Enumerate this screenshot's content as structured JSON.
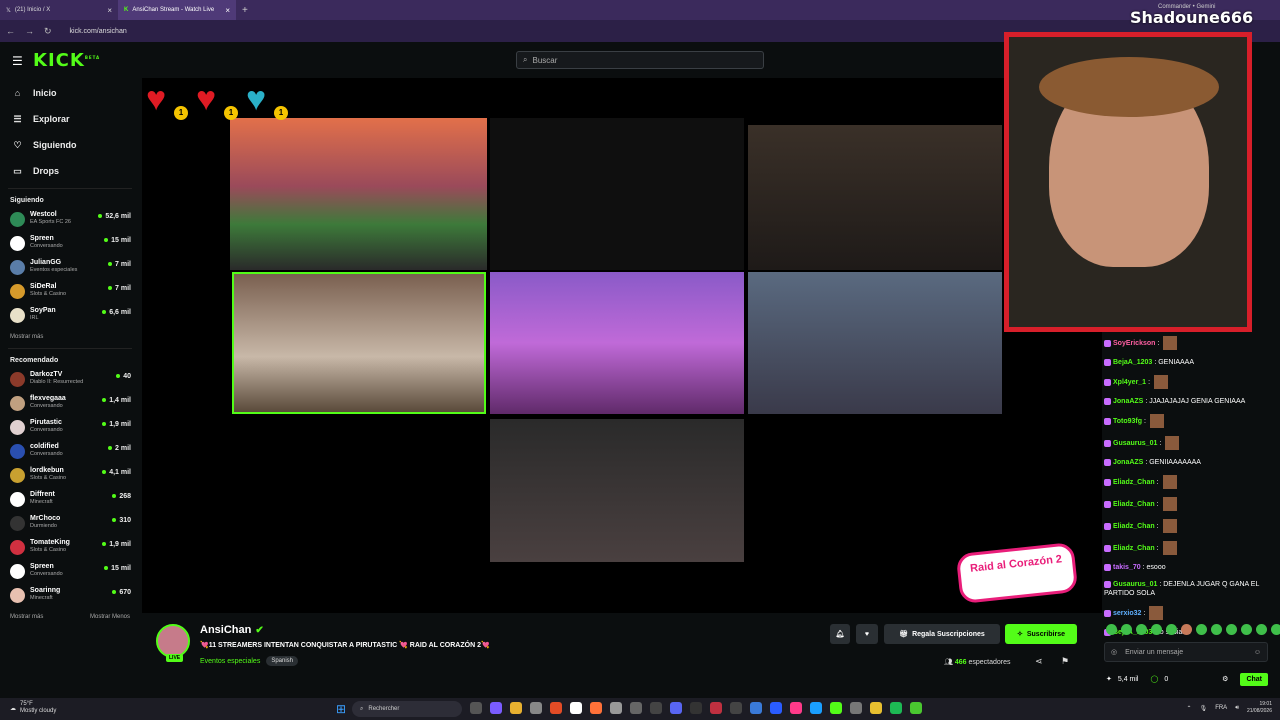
{
  "browser": {
    "tabs": [
      {
        "label": "(21) Inicio / X",
        "active": false
      },
      {
        "label": "AnsiChan Stream - Watch Live",
        "active": true
      }
    ],
    "url": "kick.com/ansichan"
  },
  "topbar": {
    "logo": "KICK",
    "logo_sup": "BETA",
    "search_placeholder": "Buscar"
  },
  "sidebar": {
    "nav": [
      {
        "label": "Inicio",
        "icon": "home-icon"
      },
      {
        "label": "Explorar",
        "icon": "compass-icon"
      },
      {
        "label": "Siguiendo",
        "icon": "heart-icon"
      },
      {
        "label": "Drops",
        "icon": "drops-icon"
      }
    ],
    "following_title": "Siguiendo",
    "following": [
      {
        "name": "Westcol",
        "category": "EA Sports FC 26",
        "viewers": "52,6 mil",
        "color": "#2e8b57"
      },
      {
        "name": "Spreen",
        "category": "Conversando",
        "viewers": "15 mil",
        "color": "#ffffff"
      },
      {
        "name": "JulianGG",
        "category": "Eventos especiales",
        "viewers": "7 mil",
        "color": "#5a7da8"
      },
      {
        "name": "SiDeRal",
        "category": "Slots & Casino",
        "viewers": "7 mil",
        "color": "#d69a2b"
      },
      {
        "name": "SoyPan",
        "category": "IRL",
        "viewers": "6,6 mil",
        "color": "#e8e0c8"
      }
    ],
    "following_more": "Mostrar más",
    "recommended_title": "Recomendado",
    "recommended": [
      {
        "name": "DarkozTV",
        "category": "Diablo II: Resurrected",
        "viewers": "40",
        "color": "#8b3a2a"
      },
      {
        "name": "flexvegaaa",
        "category": "Conversando",
        "viewers": "1,4 mil",
        "color": "#c0a080"
      },
      {
        "name": "Pirutastic",
        "category": "Conversando",
        "viewers": "1,9 mil",
        "color": "#e0d0d0"
      },
      {
        "name": "coldified",
        "category": "Conversando",
        "viewers": "2 mil",
        "color": "#2a4fb0"
      },
      {
        "name": "lordkebun",
        "category": "Slots & Casino",
        "viewers": "4,1 mil",
        "color": "#c8a030"
      },
      {
        "name": "Diffrent",
        "category": "Minecraft",
        "viewers": "268",
        "color": "#ffffff"
      },
      {
        "name": "MrChoco",
        "category": "Durmiendo",
        "viewers": "310",
        "color": "#333333"
      },
      {
        "name": "TomateKing",
        "category": "Slots & Casino",
        "viewers": "1,9 mil",
        "color": "#d03040"
      },
      {
        "name": "Spreen",
        "category": "Conversando",
        "viewers": "15 mil",
        "color": "#ffffff"
      },
      {
        "name": "Soarinng",
        "category": "Minecraft",
        "viewers": "670",
        "color": "#e8c0b0"
      }
    ],
    "recommended_more": "Mostrar más",
    "recommended_less": "Mostrar Menos"
  },
  "video": {
    "heart_badges": [
      "1",
      "1",
      "1"
    ],
    "raid_text": "Raid al Corazón 2",
    "cam_name": "Shadoune666",
    "cam_sub": "Commander • Gemini"
  },
  "stream": {
    "name": "AnsiChan",
    "title": "💘11 STREAMERS INTENTAN CONQUISTAR A PIRUTASTIC 💘 RAID AL CORAZÓN 2💘",
    "category": "Eventos especiales",
    "language": "Spanish",
    "live_label": "LIVE",
    "gift_button": "Regala Suscripciones",
    "subscribe_button": "Suscribirse",
    "viewers": "466",
    "viewers_label": "espectadores"
  },
  "chat": {
    "messages": [
      {
        "user": "SoyErickson",
        "color": "#ff5fa2",
        "text": "",
        "emotes": 1
      },
      {
        "user": "BejaA_1203",
        "color": "#53fc18",
        "text": "GENIAAAA",
        "emotes": 0
      },
      {
        "user": "Xpl4yer_1",
        "color": "#53fc18",
        "text": "",
        "emotes": 1
      },
      {
        "user": "JonaAZS",
        "color": "#53fc18",
        "text": "JJAJAJAJAJ GENIA GENIAAA",
        "emotes": 0
      },
      {
        "user": "Toto93fg",
        "color": "#53fc18",
        "text": "",
        "emotes": 1
      },
      {
        "user": "Gusaurus_01",
        "color": "#53fc18",
        "text": "",
        "emotes": 1
      },
      {
        "user": "JonaAZS",
        "color": "#53fc18",
        "text": "GENIIAAAAAAA",
        "emotes": 0
      },
      {
        "user": "Eliadz_Chan",
        "color": "#53fc18",
        "text": "",
        "emotes": 1
      },
      {
        "user": "Eliadz_Chan",
        "color": "#53fc18",
        "text": "",
        "emotes": 1
      },
      {
        "user": "Eliadz_Chan",
        "color": "#53fc18",
        "text": "",
        "emotes": 1
      },
      {
        "user": "Eliadz_Chan",
        "color": "#53fc18",
        "text": "",
        "emotes": 1
      },
      {
        "user": "takis_70",
        "color": "#c86cff",
        "text": "esooo",
        "emotes": 0
      },
      {
        "user": "Gusaurus_01",
        "color": "#53fc18",
        "text": "DEJENLA JUGAR Q GANA EL PARTIDO SOLA",
        "emotes": 0
      },
      {
        "user": "serxio32",
        "color": "#5fb0ff",
        "text": "",
        "emotes": 1
      },
      {
        "user": "BejaA_1203",
        "color": "#53fc18",
        "text": "lo sabiaaa",
        "emotes": 0
      }
    ],
    "input_placeholder": "Enviar un mensaje",
    "points": "5,4 mil",
    "kicks": "0",
    "chat_button": "Chat"
  },
  "taskbar": {
    "temperature": "75°F",
    "weather": "Mostly cloudy",
    "search_label": "Rechercher",
    "language": "FRA",
    "time": "19:01",
    "date": "21/08/2026"
  }
}
